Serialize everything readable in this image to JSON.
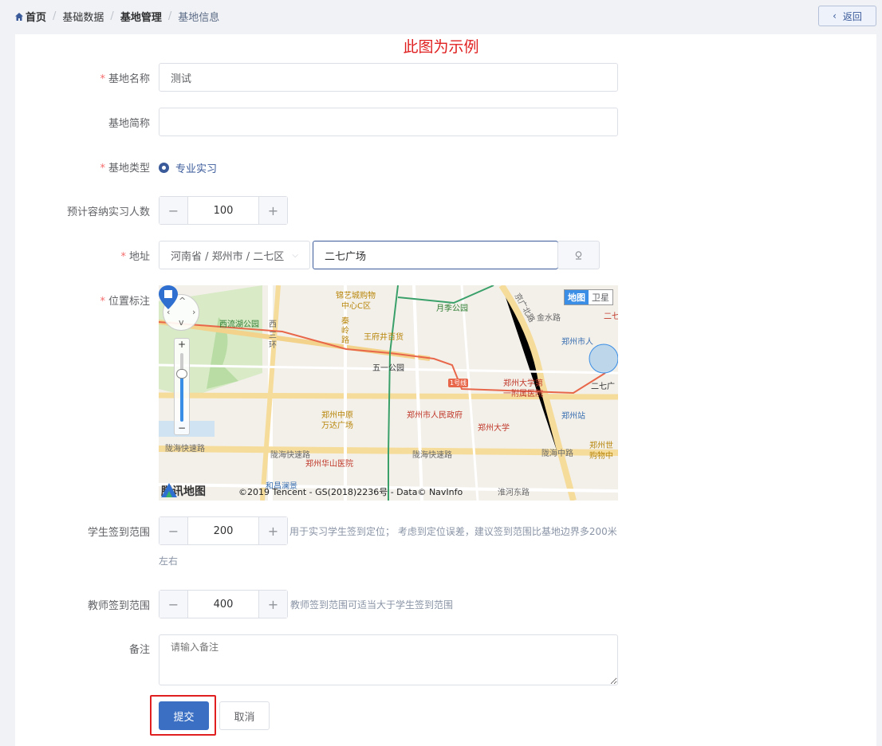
{
  "breadcrumb": {
    "items": [
      "首页",
      "基础数据",
      "基地管理",
      "基地信息"
    ],
    "separator": "/"
  },
  "header": {
    "back_label": "返回"
  },
  "watermark": "此图为示例",
  "form": {
    "name": {
      "label": "基地名称",
      "value": "测试"
    },
    "short_name": {
      "label": "基地简称",
      "value": ""
    },
    "type": {
      "label": "基地类型",
      "option": "专业实习"
    },
    "capacity": {
      "label": "预计容纳实习人数",
      "value": "100"
    },
    "address": {
      "label": "地址",
      "region": "河南省 / 郑州市 / 二七区",
      "detail": "二七广场"
    },
    "location": {
      "label": "位置标注"
    },
    "student_range": {
      "label": "学生签到范围",
      "value": "200",
      "hint_line1": "用于实习学生签到定位； 考虑到定位误差，建议签到范围比基地边界多200米",
      "hint_line2": "左右"
    },
    "teacher_range": {
      "label": "教师签到范围",
      "value": "400",
      "hint": "教师签到范围可适当大于学生签到范围"
    },
    "remark": {
      "label": "备注",
      "placeholder": "请输入备注"
    },
    "submit_label": "提交",
    "cancel_label": "取消"
  },
  "map": {
    "toggle_map": "地图",
    "toggle_satellite": "卫星",
    "logo": "腾讯地图",
    "copyright": "©2019 Tencent - GS(2018)2236号 - Data© NavInfo",
    "labels": {
      "l1": "锦艺城购物",
      "l2": "中心C区",
      "l3": "月季公园",
      "l4": "西流湖公园",
      "l5": "西",
      "l6": "王府井百货",
      "l7": "五一公园",
      "l8": "郑州大学第",
      "l9": "一附属医院",
      "l10": "郑州市人",
      "l11": "二七广",
      "l12": "郑州站",
      "l13": "郑州中原",
      "l14": "万达广场",
      "l15": "郑州市人民政府",
      "l16": "郑州大学",
      "l17": "陇海快速路",
      "l18": "陇海快速路",
      "l19": "陇海快速路",
      "l20": "陇海中路",
      "l21": "郑州华山医院",
      "l22": "和昌澜景",
      "l23": "淮河东路",
      "l24": "郑州世",
      "l25": "购物中",
      "l26": "京广北路",
      "l27": "金水路",
      "l28": "1号线",
      "l29": "秦",
      "l30": "岭",
      "l31": "路",
      "l32": "二七",
      "l33": "三",
      "l34": "环"
    }
  }
}
